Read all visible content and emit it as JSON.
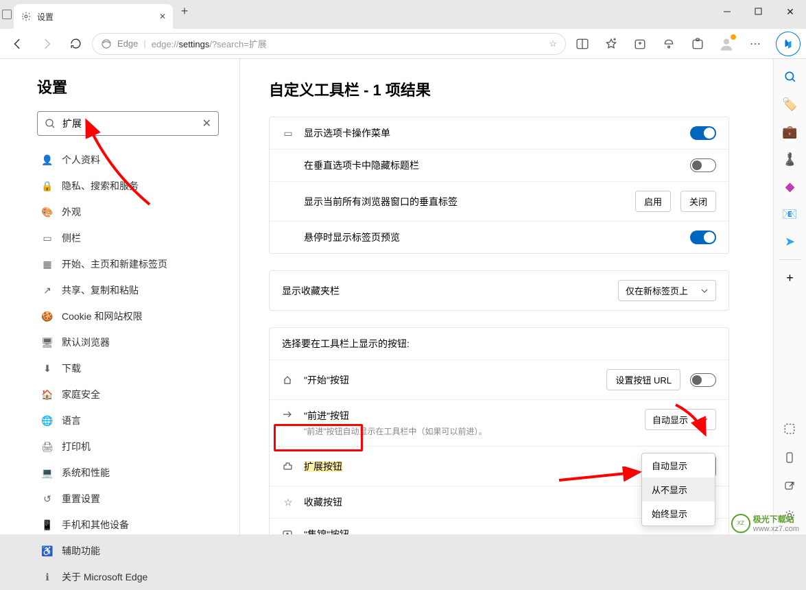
{
  "tab": {
    "title": "设置"
  },
  "addressbar": {
    "browser": "Edge",
    "prefix": "edge://",
    "bold": "settings",
    "suffix": "/?search=扩展"
  },
  "searchbox": {
    "value": "扩展"
  },
  "sidebar_title": "设置",
  "nav": [
    "个人资料",
    "隐私、搜索和服务",
    "外观",
    "侧栏",
    "开始、主页和新建标签页",
    "共享、复制和粘贴",
    "Cookie 和网站权限",
    "默认浏览器",
    "下载",
    "家庭安全",
    "语言",
    "打印机",
    "系统和性能",
    "重置设置",
    "手机和其他设备",
    "辅助功能",
    "关于 Microsoft Edge"
  ],
  "heading": "自定义工具栏 - 1 项结果",
  "card1": {
    "r1": "显示选项卡操作菜单",
    "r2": "在垂直选项卡中隐藏标题栏",
    "r3": "显示当前所有浏览器窗口的垂直标签",
    "r3_enable": "启用",
    "r3_close": "关闭",
    "r4": "悬停时显示标签页预览"
  },
  "card2": {
    "r1": "显示收藏夹栏",
    "r1_val": "仅在新标签页上"
  },
  "card3": {
    "title": "选择要在工具栏上显示的按钮:",
    "home": "\"开始\"按钮",
    "home_btn": "设置按钮 URL",
    "forward": "\"前进\"按钮",
    "forward_sub": "\"前进\"按钮自动显示在工具栏中（如果可以前进）。",
    "forward_val": "自动显示",
    "ext": "扩展按钮",
    "ext_val": "从不显示",
    "fav": "收藏按钮",
    "coll": "\"集锦\"按钮"
  },
  "dropdown_options": [
    "自动显示",
    "从不显示",
    "始终显示"
  ],
  "watermark": {
    "line1": "极光下载站",
    "line2": "www.xz7.com"
  }
}
